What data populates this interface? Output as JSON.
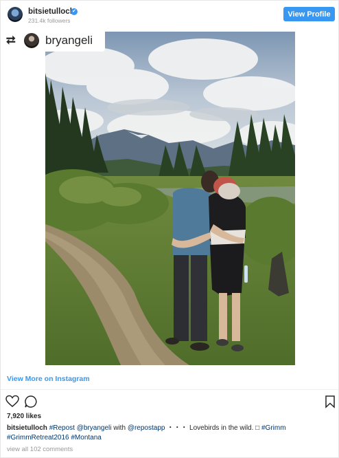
{
  "post": {
    "username": "bitsietulloch",
    "verified_glyph": "✔",
    "followers": "231.4k followers",
    "view_profile_label": "View Profile",
    "avatar_icon": "user-avatar-icon",
    "repost": {
      "icon": "repost-icon",
      "icon_glyph": "⮂",
      "username": "bryangeli"
    },
    "photo": {
      "icon": "photo-couple-hugging-on-trail"
    },
    "view_more_label": "View More on Instagram",
    "actions": {
      "like_icon": "heart-icon",
      "comment_icon": "comment-icon",
      "bookmark_icon": "bookmark-icon"
    },
    "likes": "7,920 likes",
    "caption": {
      "username": "bitsietulloch",
      "repost_tag": "#Repost",
      "mention": "@bryangeli",
      "with": "with",
      "app_mention": "@repostapp",
      "dots": "・・・",
      "text": "Lovebirds in the wild. □",
      "tag1": "#Grimm",
      "tag2": "#GrimmRetreat2016",
      "tag3": "#Montana"
    },
    "comments_label": "view all 102 comments"
  },
  "colors": {
    "accent": "#3897f0",
    "hashtag": "#003569",
    "muted": "#999999",
    "text": "#262626"
  }
}
